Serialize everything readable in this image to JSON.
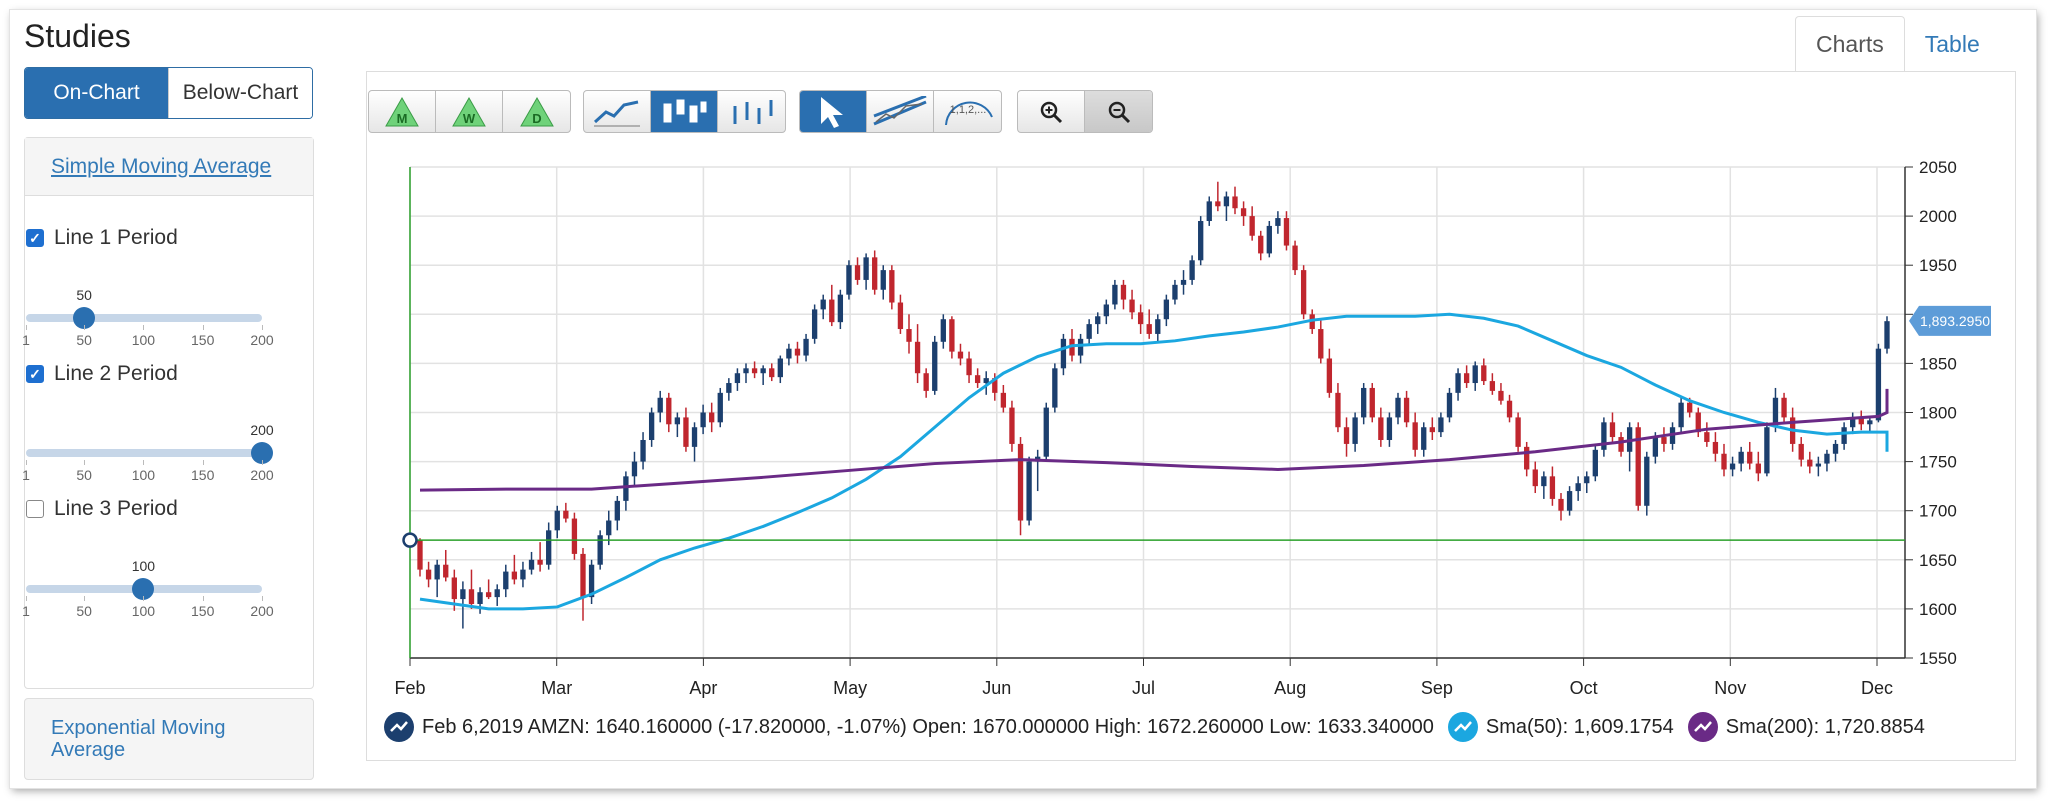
{
  "sidebar": {
    "title": "Studies",
    "segment": {
      "on_chart": "On-Chart",
      "below_chart": "Below-Chart",
      "active": "On-Chart"
    },
    "sma": {
      "heading": "Simple Moving Average",
      "lines": [
        {
          "label": "Line 1 Period",
          "checked": true,
          "value": 50,
          "value_label": "50"
        },
        {
          "label": "Line 2 Period",
          "checked": true,
          "value": 200,
          "value_label": "200"
        },
        {
          "label": "Line 3 Period",
          "checked": false,
          "value": 100,
          "value_label": "100"
        }
      ],
      "slider_min": 1,
      "slider_max": 200,
      "tick_labels": [
        "1",
        "50",
        "100",
        "150",
        "200"
      ]
    },
    "ema": {
      "heading": "Exponential Moving Average"
    }
  },
  "tabs": {
    "charts": "Charts",
    "table": "Table",
    "active": "Charts"
  },
  "toolbar": {
    "periods": [
      "M",
      "W",
      "D"
    ],
    "chart_types": [
      "line-chart-icon",
      "candlestick-icon",
      "ohlc-icon"
    ],
    "chart_type_selected": "candlestick-icon",
    "tools": [
      "pointer-icon",
      "trendline-icon",
      "fibonacci-icon"
    ],
    "tool_selected": "pointer-icon",
    "zoom": [
      "zoom-in-icon",
      "zoom-out-icon"
    ],
    "zoom_pressed": "zoom-out-icon",
    "fib_label": "1,1,2,..."
  },
  "chart_data": {
    "type": "candlestick",
    "symbol": "AMZN",
    "ylim": [
      1550,
      2050
    ],
    "y_ticks": [
      1550,
      1600,
      1650,
      1700,
      1750,
      1800,
      1850,
      1900,
      1950,
      2000,
      2050
    ],
    "x_labels": [
      "Feb",
      "Mar",
      "Apr",
      "May",
      "Jun",
      "Jul",
      "Aug",
      "Sep",
      "Oct",
      "Nov",
      "Dec"
    ],
    "last_price_label": "1,893.2950",
    "last_price": 1893.295,
    "crosshair_price": 1670,
    "colors": {
      "up": "#1c3f6e",
      "down": "#c0262e",
      "sma50": "#1ba7e0",
      "sma200": "#6a2a86",
      "crosshair": "#2aa02a"
    },
    "series": [
      {
        "name": "Sma(50)",
        "x": [
          0,
          4,
          8,
          12,
          16,
          20,
          24,
          28,
          32,
          36,
          40,
          44,
          48,
          52,
          56,
          60,
          64,
          68,
          72,
          76,
          80,
          84,
          88,
          92,
          96,
          100,
          104,
          108,
          112,
          116,
          120,
          124,
          128,
          132,
          136,
          140,
          144,
          148,
          152,
          156,
          160,
          164,
          168,
          172,
          176,
          180,
          184,
          188,
          192,
          196,
          200,
          204,
          208,
          212,
          216,
          220,
          222
        ],
        "values": [
          1610,
          1605,
          1600,
          1600,
          1602,
          1615,
          1632,
          1650,
          1662,
          1672,
          1684,
          1698,
          1713,
          1732,
          1755,
          1785,
          1815,
          1840,
          1857,
          1868,
          1870,
          1870,
          1873,
          1878,
          1882,
          1887,
          1894,
          1898,
          1898,
          1898,
          1900,
          1896,
          1888,
          1873,
          1858,
          1846,
          1828,
          1812,
          1800,
          1790,
          1782,
          1778,
          1780,
          1780,
          1780,
          1778,
          1773,
          1768,
          1762,
          1760,
          1762,
          1765,
          1766,
          1766,
          1767,
          1770,
          1775
        ]
      },
      {
        "name": "Sma(200)",
        "x": [
          0,
          10,
          20,
          30,
          40,
          50,
          60,
          70,
          80,
          90,
          100,
          110,
          120,
          130,
          140,
          150,
          160,
          170,
          180,
          190,
          200,
          210,
          220,
          222
        ],
        "values": [
          1721,
          1722,
          1722,
          1728,
          1734,
          1741,
          1748,
          1752,
          1749,
          1745,
          1742,
          1746,
          1752,
          1760,
          1770,
          1783,
          1790,
          1796,
          1800,
          1806,
          1813,
          1818,
          1821,
          1824
        ]
      }
    ],
    "candles": [
      [
        1670,
        1672,
        1633,
        1640
      ],
      [
        1640,
        1648,
        1622,
        1630
      ],
      [
        1630,
        1650,
        1612,
        1645
      ],
      [
        1645,
        1660,
        1628,
        1632
      ],
      [
        1632,
        1640,
        1598,
        1610
      ],
      [
        1610,
        1628,
        1580,
        1620
      ],
      [
        1620,
        1640,
        1600,
        1605
      ],
      [
        1605,
        1622,
        1595,
        1617
      ],
      [
        1617,
        1630,
        1610,
        1612
      ],
      [
        1612,
        1625,
        1603,
        1620
      ],
      [
        1620,
        1645,
        1612,
        1638
      ],
      [
        1638,
        1655,
        1625,
        1630
      ],
      [
        1630,
        1648,
        1622,
        1640
      ],
      [
        1640,
        1658,
        1635,
        1650
      ],
      [
        1650,
        1668,
        1638,
        1645
      ],
      [
        1645,
        1688,
        1640,
        1680
      ],
      [
        1680,
        1705,
        1672,
        1700
      ],
      [
        1700,
        1708,
        1688,
        1692
      ],
      [
        1692,
        1698,
        1650,
        1656
      ],
      [
        1656,
        1662,
        1588,
        1612
      ],
      [
        1612,
        1650,
        1605,
        1645
      ],
      [
        1645,
        1680,
        1640,
        1675
      ],
      [
        1675,
        1700,
        1665,
        1690
      ],
      [
        1690,
        1715,
        1680,
        1710
      ],
      [
        1710,
        1740,
        1700,
        1735
      ],
      [
        1735,
        1760,
        1725,
        1750
      ],
      [
        1750,
        1780,
        1742,
        1772
      ],
      [
        1772,
        1805,
        1765,
        1800
      ],
      [
        1800,
        1822,
        1790,
        1815
      ],
      [
        1815,
        1820,
        1780,
        1788
      ],
      [
        1788,
        1800,
        1775,
        1795
      ],
      [
        1795,
        1805,
        1760,
        1765
      ],
      [
        1765,
        1790,
        1750,
        1785
      ],
      [
        1785,
        1808,
        1778,
        1800
      ],
      [
        1800,
        1810,
        1780,
        1790
      ],
      [
        1790,
        1825,
        1785,
        1820
      ],
      [
        1820,
        1835,
        1812,
        1830
      ],
      [
        1830,
        1845,
        1822,
        1840
      ],
      [
        1840,
        1850,
        1830,
        1845
      ],
      [
        1845,
        1852,
        1835,
        1840
      ],
      [
        1840,
        1848,
        1828,
        1845
      ],
      [
        1845,
        1850,
        1832,
        1836
      ],
      [
        1836,
        1858,
        1830,
        1855
      ],
      [
        1855,
        1870,
        1848,
        1865
      ],
      [
        1865,
        1872,
        1850,
        1858
      ],
      [
        1858,
        1880,
        1852,
        1875
      ],
      [
        1875,
        1910,
        1870,
        1905
      ],
      [
        1905,
        1920,
        1895,
        1915
      ],
      [
        1915,
        1930,
        1888,
        1892
      ],
      [
        1892,
        1925,
        1885,
        1920
      ],
      [
        1920,
        1955,
        1915,
        1950
      ],
      [
        1950,
        1958,
        1930,
        1935
      ],
      [
        1935,
        1962,
        1925,
        1958
      ],
      [
        1958,
        1965,
        1920,
        1925
      ],
      [
        1925,
        1950,
        1915,
        1945
      ],
      [
        1945,
        1950,
        1905,
        1912
      ],
      [
        1912,
        1920,
        1880,
        1885
      ],
      [
        1885,
        1900,
        1860,
        1872
      ],
      [
        1872,
        1890,
        1830,
        1840
      ],
      [
        1840,
        1845,
        1815,
        1822
      ],
      [
        1822,
        1878,
        1818,
        1872
      ],
      [
        1872,
        1900,
        1865,
        1895
      ],
      [
        1895,
        1898,
        1855,
        1862
      ],
      [
        1862,
        1870,
        1848,
        1855
      ],
      [
        1855,
        1862,
        1830,
        1838
      ],
      [
        1838,
        1845,
        1825,
        1830
      ],
      [
        1830,
        1842,
        1818,
        1835
      ],
      [
        1835,
        1840,
        1812,
        1820
      ],
      [
        1820,
        1828,
        1800,
        1805
      ],
      [
        1805,
        1812,
        1760,
        1768
      ],
      [
        1768,
        1775,
        1675,
        1690
      ],
      [
        1690,
        1755,
        1685,
        1750
      ],
      [
        1750,
        1762,
        1720,
        1755
      ],
      [
        1755,
        1810,
        1750,
        1805
      ],
      [
        1805,
        1850,
        1800,
        1845
      ],
      [
        1845,
        1880,
        1838,
        1875
      ],
      [
        1875,
        1885,
        1852,
        1858
      ],
      [
        1858,
        1880,
        1850,
        1875
      ],
      [
        1875,
        1895,
        1868,
        1890
      ],
      [
        1890,
        1902,
        1880,
        1898
      ],
      [
        1898,
        1915,
        1890,
        1910
      ],
      [
        1910,
        1935,
        1905,
        1930
      ],
      [
        1930,
        1935,
        1905,
        1915
      ],
      [
        1915,
        1925,
        1895,
        1902
      ],
      [
        1902,
        1910,
        1880,
        1890
      ],
      [
        1890,
        1905,
        1875,
        1880
      ],
      [
        1880,
        1900,
        1872,
        1895
      ],
      [
        1895,
        1920,
        1888,
        1915
      ],
      [
        1915,
        1935,
        1910,
        1930
      ],
      [
        1930,
        1945,
        1920,
        1935
      ],
      [
        1935,
        1960,
        1930,
        1955
      ],
      [
        1955,
        2000,
        1950,
        1995
      ],
      [
        1995,
        2020,
        1990,
        2015
      ],
      [
        2015,
        2035,
        2005,
        2010
      ],
      [
        2010,
        2025,
        1995,
        2020
      ],
      [
        2020,
        2030,
        2002,
        2008
      ],
      [
        2008,
        2015,
        1990,
        2000
      ],
      [
        2000,
        2010,
        1975,
        1980
      ],
      [
        1980,
        1985,
        1955,
        1962
      ],
      [
        1962,
        1995,
        1958,
        1990
      ],
      [
        1990,
        2005,
        1982,
        1998
      ],
      [
        1998,
        2005,
        1965,
        1970
      ],
      [
        1970,
        1975,
        1940,
        1945
      ],
      [
        1945,
        1950,
        1895,
        1900
      ],
      [
        1900,
        1905,
        1880,
        1885
      ],
      [
        1885,
        1895,
        1850,
        1855
      ],
      [
        1855,
        1865,
        1815,
        1820
      ],
      [
        1820,
        1830,
        1780,
        1785
      ],
      [
        1785,
        1795,
        1755,
        1768
      ],
      [
        1768,
        1800,
        1760,
        1795
      ],
      [
        1795,
        1830,
        1788,
        1825
      ],
      [
        1825,
        1830,
        1790,
        1795
      ],
      [
        1795,
        1805,
        1765,
        1772
      ],
      [
        1772,
        1800,
        1765,
        1795
      ],
      [
        1795,
        1820,
        1788,
        1815
      ],
      [
        1815,
        1822,
        1785,
        1790
      ],
      [
        1790,
        1800,
        1755,
        1762
      ],
      [
        1762,
        1790,
        1755,
        1785
      ],
      [
        1785,
        1795,
        1772,
        1780
      ],
      [
        1780,
        1800,
        1775,
        1795
      ],
      [
        1795,
        1825,
        1790,
        1820
      ],
      [
        1820,
        1845,
        1812,
        1840
      ],
      [
        1840,
        1848,
        1825,
        1830
      ],
      [
        1830,
        1852,
        1822,
        1848
      ],
      [
        1848,
        1855,
        1828,
        1832
      ],
      [
        1832,
        1840,
        1818,
        1822
      ],
      [
        1822,
        1830,
        1808,
        1812
      ],
      [
        1812,
        1818,
        1790,
        1795
      ],
      [
        1795,
        1800,
        1760,
        1765
      ],
      [
        1765,
        1770,
        1735,
        1742
      ],
      [
        1742,
        1750,
        1718,
        1725
      ],
      [
        1725,
        1740,
        1712,
        1735
      ],
      [
        1735,
        1745,
        1705,
        1712
      ],
      [
        1712,
        1718,
        1690,
        1700
      ],
      [
        1700,
        1725,
        1695,
        1720
      ],
      [
        1720,
        1735,
        1710,
        1728
      ],
      [
        1728,
        1740,
        1718,
        1735
      ],
      [
        1735,
        1768,
        1730,
        1762
      ],
      [
        1762,
        1795,
        1755,
        1790
      ],
      [
        1790,
        1800,
        1770,
        1775
      ],
      [
        1775,
        1780,
        1755,
        1760
      ],
      [
        1760,
        1790,
        1740,
        1785
      ],
      [
        1785,
        1790,
        1700,
        1705
      ],
      [
        1705,
        1760,
        1695,
        1755
      ],
      [
        1755,
        1780,
        1748,
        1775
      ],
      [
        1775,
        1785,
        1760,
        1768
      ],
      [
        1768,
        1790,
        1762,
        1785
      ],
      [
        1785,
        1815,
        1780,
        1810
      ],
      [
        1810,
        1815,
        1795,
        1800
      ],
      [
        1800,
        1805,
        1775,
        1780
      ],
      [
        1780,
        1790,
        1765,
        1770
      ],
      [
        1770,
        1780,
        1750,
        1758
      ],
      [
        1758,
        1768,
        1735,
        1742
      ],
      [
        1742,
        1755,
        1735,
        1748
      ],
      [
        1748,
        1765,
        1740,
        1760
      ],
      [
        1760,
        1770,
        1742,
        1748
      ],
      [
        1748,
        1760,
        1730,
        1738
      ],
      [
        1738,
        1790,
        1735,
        1785
      ],
      [
        1785,
        1825,
        1780,
        1815
      ],
      [
        1815,
        1820,
        1790,
        1795
      ],
      [
        1795,
        1805,
        1760,
        1768
      ],
      [
        1768,
        1775,
        1745,
        1752
      ],
      [
        1752,
        1760,
        1738,
        1745
      ],
      [
        1745,
        1755,
        1735,
        1748
      ],
      [
        1748,
        1762,
        1740,
        1758
      ],
      [
        1758,
        1772,
        1750,
        1768
      ],
      [
        1768,
        1790,
        1762,
        1785
      ],
      [
        1785,
        1800,
        1778,
        1795
      ],
      [
        1795,
        1802,
        1782,
        1788
      ],
      [
        1788,
        1795,
        1780,
        1792
      ],
      [
        1792,
        1870,
        1790,
        1865
      ],
      [
        1865,
        1898,
        1860,
        1893
      ]
    ]
  },
  "legend": {
    "price_text": "Feb 6,2019 AMZN: 1640.160000 (-17.820000, -1.07%) Open: 1670.000000 High: 1672.260000 Low: 1633.340000",
    "sma50_text": "Sma(50): 1,609.1754",
    "sma200_text": "Sma(200): 1,720.8854"
  }
}
